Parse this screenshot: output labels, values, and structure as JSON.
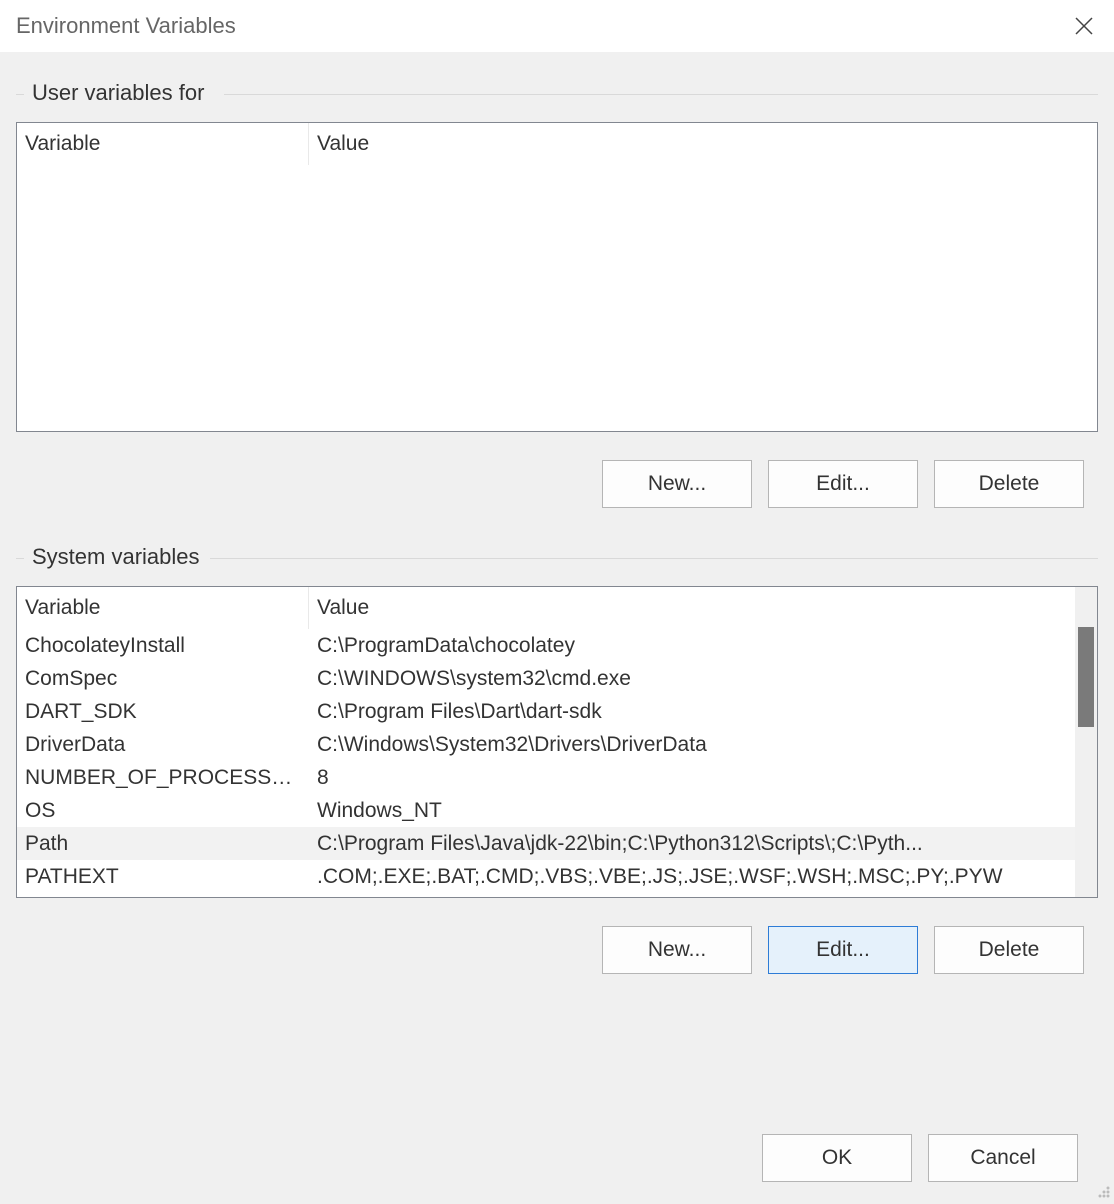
{
  "title": "Environment Variables",
  "userGroup": {
    "legend": "User variables for",
    "headers": {
      "variable": "Variable",
      "value": "Value"
    },
    "rows": [],
    "buttons": {
      "new": "New...",
      "edit": "Edit...",
      "delete": "Delete"
    }
  },
  "systemGroup": {
    "legend": "System variables",
    "headers": {
      "variable": "Variable",
      "value": "Value"
    },
    "rows": [
      {
        "variable": "ChocolateyInstall",
        "value": "C:\\ProgramData\\chocolatey",
        "selected": false
      },
      {
        "variable": "ComSpec",
        "value": "C:\\WINDOWS\\system32\\cmd.exe",
        "selected": false
      },
      {
        "variable": "DART_SDK",
        "value": "C:\\Program Files\\Dart\\dart-sdk",
        "selected": false
      },
      {
        "variable": "DriverData",
        "value": "C:\\Windows\\System32\\Drivers\\DriverData",
        "selected": false
      },
      {
        "variable": "NUMBER_OF_PROCESSORS",
        "value": "8",
        "selected": false
      },
      {
        "variable": "OS",
        "value": "Windows_NT",
        "selected": false
      },
      {
        "variable": "Path",
        "value": "C:\\Program Files\\Java\\jdk-22\\bin;C:\\Python312\\Scripts\\;C:\\Pyth...",
        "selected": true
      },
      {
        "variable": "PATHEXT",
        "value": ".COM;.EXE;.BAT;.CMD;.VBS;.VBE;.JS;.JSE;.WSF;.WSH;.MSC;.PY;.PYW",
        "selected": false
      }
    ],
    "buttons": {
      "new": "New...",
      "edit": "Edit...",
      "delete": "Delete"
    }
  },
  "footer": {
    "ok": "OK",
    "cancel": "Cancel"
  }
}
